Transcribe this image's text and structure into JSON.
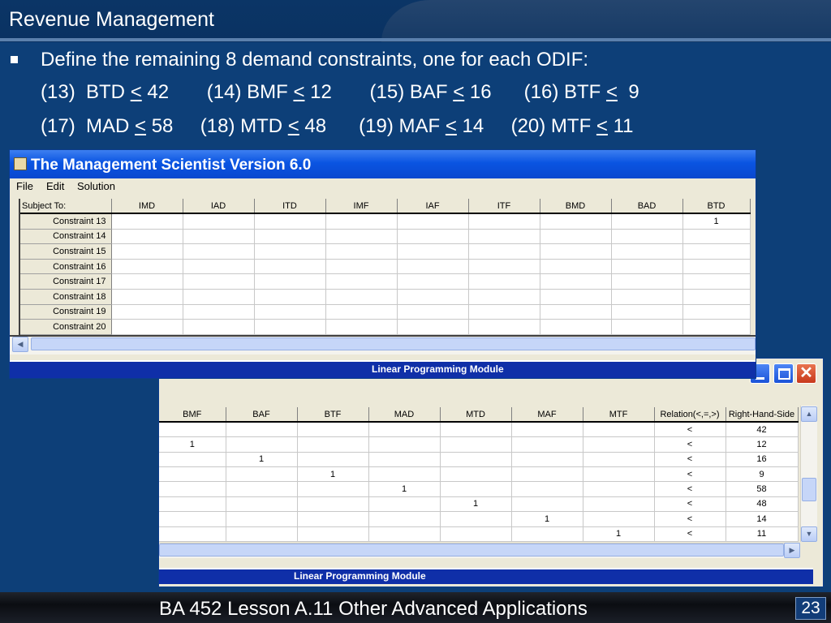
{
  "slide": {
    "title": "Revenue Management",
    "bullet": "Define the remaining 8 demand constraints, one for each ODIF:",
    "row1": [
      {
        "prefix": "(13)  BTD ",
        "sym": "<",
        "value": " 42"
      },
      {
        "prefix": "(14) BMF ",
        "sym": "<",
        "value": " 12"
      },
      {
        "prefix": "(15) BAF ",
        "sym": "<",
        "value": " 16"
      },
      {
        "prefix": "(16) BTF ",
        "sym": "<",
        "value": "  9"
      }
    ],
    "row2": [
      {
        "prefix": "(17)  MAD ",
        "sym": "<",
        "value": " 58"
      },
      {
        "prefix": "(18) MTD ",
        "sym": "<",
        "value": " 48"
      },
      {
        "prefix": "(19) MAF ",
        "sym": "<",
        "value": " 14"
      },
      {
        "prefix": "(20) MTF ",
        "sym": "<",
        "value": " 11"
      }
    ],
    "footer": "BA 452  Lesson A.11 Other Advanced Applications",
    "page_number": "23"
  },
  "front_window": {
    "title": "The Management Scientist Version 6.0",
    "menu": [
      "File",
      "Edit",
      "Solution"
    ],
    "corner_label": "Subject To:",
    "columns": [
      "IMD",
      "IAD",
      "ITD",
      "IMF",
      "IAF",
      "ITF",
      "BMD",
      "BAD",
      "BTD"
    ],
    "rows": [
      {
        "label": "Constraint 13",
        "cells": [
          "",
          "",
          "",
          "",
          "",
          "",
          "",
          "",
          "1"
        ]
      },
      {
        "label": "Constraint 14",
        "cells": [
          "",
          "",
          "",
          "",
          "",
          "",
          "",
          "",
          ""
        ]
      },
      {
        "label": "Constraint 15",
        "cells": [
          "",
          "",
          "",
          "",
          "",
          "",
          "",
          "",
          ""
        ]
      },
      {
        "label": "Constraint 16",
        "cells": [
          "",
          "",
          "",
          "",
          "",
          "",
          "",
          "",
          ""
        ]
      },
      {
        "label": "Constraint 17",
        "cells": [
          "",
          "",
          "",
          "",
          "",
          "",
          "",
          "",
          ""
        ]
      },
      {
        "label": "Constraint 18",
        "cells": [
          "",
          "",
          "",
          "",
          "",
          "",
          "",
          "",
          ""
        ]
      },
      {
        "label": "Constraint 19",
        "cells": [
          "",
          "",
          "",
          "",
          "",
          "",
          "",
          "",
          ""
        ]
      },
      {
        "label": "Constraint 20",
        "cells": [
          "",
          "",
          "",
          "",
          "",
          "",
          "",
          "",
          ""
        ]
      }
    ],
    "status": "Linear Programming Module"
  },
  "back_window": {
    "columns": [
      "BMF",
      "BAF",
      "BTF",
      "MAD",
      "MTD",
      "MAF",
      "MTF",
      "Relation(<,=,>)",
      "Right-Hand-Side"
    ],
    "rows": [
      [
        "",
        "",
        "",
        "",
        "",
        "",
        "",
        "<",
        "42"
      ],
      [
        "1",
        "",
        "",
        "",
        "",
        "",
        "",
        "<",
        "12"
      ],
      [
        "",
        "1",
        "",
        "",
        "",
        "",
        "",
        "<",
        "16"
      ],
      [
        "",
        "",
        "1",
        "",
        "",
        "",
        "",
        "<",
        "9"
      ],
      [
        "",
        "",
        "",
        "1",
        "",
        "",
        "",
        "<",
        "58"
      ],
      [
        "",
        "",
        "",
        "",
        "1",
        "",
        "",
        "<",
        "48"
      ],
      [
        "",
        "",
        "",
        "",
        "",
        "1",
        "",
        "<",
        "14"
      ],
      [
        "",
        "",
        "",
        "",
        "",
        "",
        "1",
        "<",
        "11"
      ]
    ],
    "status": "Linear Programming Module"
  },
  "icons": {
    "minimize": "minimize-icon",
    "maximize": "maximize-icon",
    "close": "close-icon",
    "scroll_up": "scroll-up-icon",
    "scroll_down": "scroll-down-icon",
    "scroll_left": "scroll-left-icon",
    "scroll_right": "scroll-right-icon",
    "app": "app-icon"
  },
  "colors": {
    "slide_background": "#0d3f78",
    "titlebar_blue": "#0a54e2",
    "status_bar_blue": "#0f2fa8",
    "window_face": "#ece9d8"
  }
}
